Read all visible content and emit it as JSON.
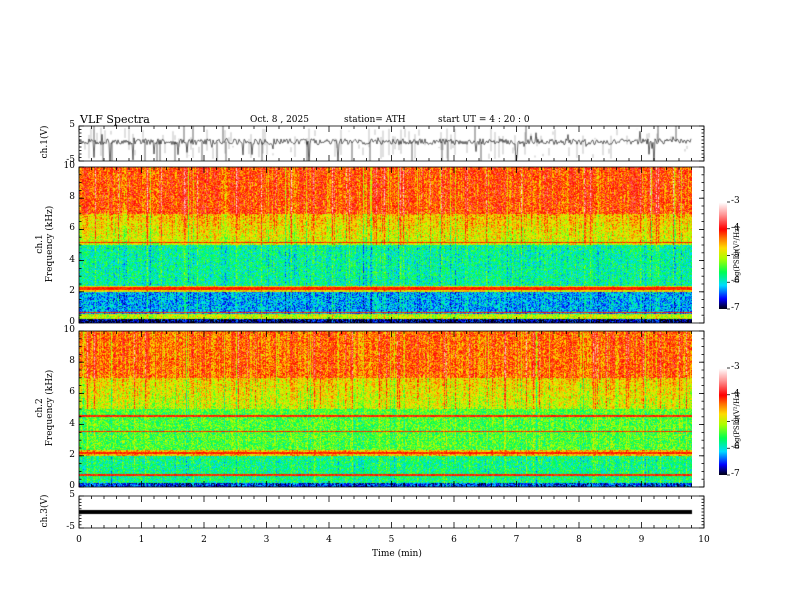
{
  "header": {
    "title": "VLF  Spectra",
    "date": "Oct. 8  , 2025",
    "station": "station= ATH",
    "start_ut": "start  UT  =   4  : 20 : 0"
  },
  "chart_data": [
    {
      "type": "line",
      "name": "ch1-waveform",
      "ylabel": "ch.1(V)",
      "ylim": [
        -5,
        5
      ],
      "yticks": [
        "5",
        "-5"
      ],
      "xlim": [
        0,
        10
      ]
    },
    {
      "type": "heatmap",
      "name": "ch1-spectrogram",
      "ylabel_line1": "ch.1",
      "ylabel_line2": "Frequency  (kHz)",
      "ylim": [
        0,
        10
      ],
      "yticks": [
        "0",
        "2",
        "4",
        "6",
        "8",
        "10"
      ],
      "xlim": [
        0,
        10
      ],
      "data_extent_min": 9.8,
      "colorbar": {
        "label": "log(PSD)(V²/Hz)",
        "range": [
          -7,
          -3
        ],
        "ticks": [
          "-3",
          "-4",
          "-5",
          "-6",
          "-7"
        ]
      }
    },
    {
      "type": "heatmap",
      "name": "ch2-spectrogram",
      "ylabel_line1": "ch.2",
      "ylabel_line2": "Frequency  (kHz)",
      "ylim": [
        0,
        10
      ],
      "yticks": [
        "0",
        "2",
        "4",
        "6",
        "8",
        "10"
      ],
      "xlim": [
        0,
        10
      ],
      "data_extent_min": 9.8,
      "colorbar": {
        "label": "log(PSD)(V²/Hz)",
        "range": [
          -7,
          -3
        ],
        "ticks": [
          "-3",
          "-4",
          "-5",
          "-6",
          "-7"
        ]
      }
    },
    {
      "type": "line",
      "name": "ch3-waveform",
      "ylabel": "ch.3(V)",
      "ylim": [
        -5,
        5
      ],
      "yticks": [
        "5",
        "-5"
      ],
      "xlim": [
        0,
        10
      ],
      "xlabel": "Time  (min)",
      "xticks": [
        "0",
        "1",
        "2",
        "3",
        "4",
        "5",
        "6",
        "7",
        "8",
        "9",
        "10"
      ]
    }
  ]
}
